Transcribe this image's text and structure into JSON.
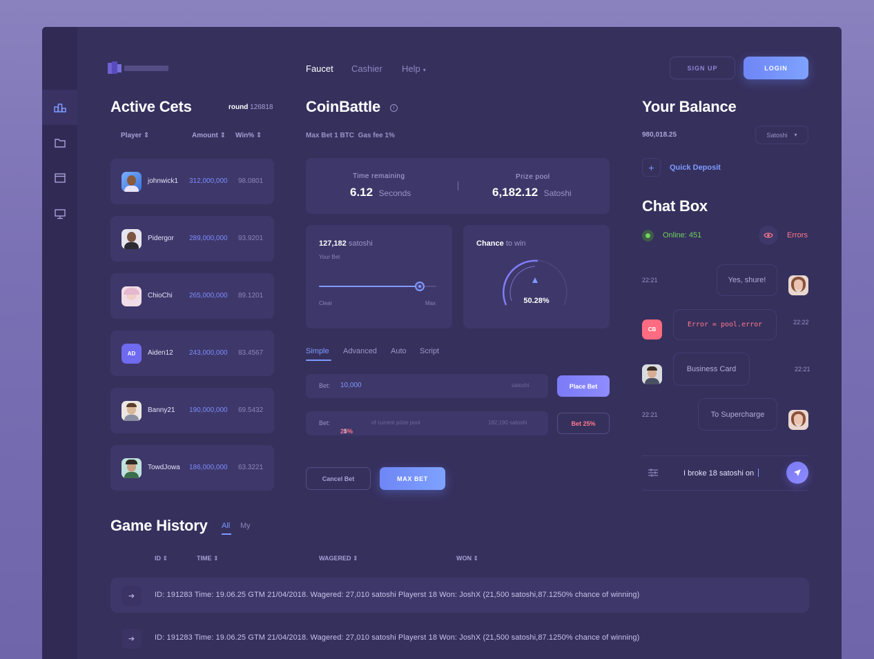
{
  "nav": {
    "faucet": "Faucet",
    "cashier": "Cashier",
    "help": "Help"
  },
  "auth": {
    "signup": "SIGN UP",
    "login": "LOGIN"
  },
  "active_bets": {
    "title": "Active Cets",
    "round_label": "round",
    "round_value": "126818",
    "columns": {
      "player": "Player",
      "amount": "Amount",
      "win": "Win%"
    },
    "rows": [
      {
        "name": "johnwick1",
        "amount": "312,000,000",
        "win": "98.0801",
        "avatar": "photo"
      },
      {
        "name": "Pidergor",
        "amount": "289,000,000",
        "win": "93.9201",
        "avatar": "photo"
      },
      {
        "name": "ChioChi",
        "amount": "265,000,000",
        "win": "89.1201",
        "avatar": "photo"
      },
      {
        "name": "Aiden12",
        "amount": "243,000,000",
        "win": "83.4567",
        "avatar": "AD"
      },
      {
        "name": "Banny21",
        "amount": "190,000,000",
        "win": "69.5432",
        "avatar": "photo"
      },
      {
        "name": "TowdJowa",
        "amount": "186,000,000",
        "win": "63.3221",
        "avatar": "photo"
      }
    ]
  },
  "coinbattle": {
    "title": "CoinBattle",
    "max_bet": "Max Bet 1 BTC",
    "gas_fee": "Gas fee 1%",
    "time_label": "Time remaining",
    "time_value": "6.12",
    "time_unit": "Seconds",
    "prize_label": "Prize pool",
    "prize_value": "6,182.12",
    "prize_unit": "Satoshi",
    "bet_value": "127,182",
    "bet_unit": "satoshi",
    "your_bet": "Your Bet",
    "clear": "Clear",
    "max": "Max",
    "slider_value": 0.86,
    "chance_label": "Chance",
    "chance_suffix": "to win",
    "chance_value": "50.28%",
    "tabs": [
      "Simple",
      "Advanced",
      "Auto",
      "Script"
    ],
    "bet_label": "Bet:",
    "bet_input": "10,000",
    "bet_input_unit": "satoshi",
    "place_bet": "Place Bet",
    "bet_pct": "25%",
    "pct_desc": "of current prize pool",
    "pct_amount": "182,190 satoshi",
    "bet25": "Bet 25%",
    "cancel": "Cancel Bet",
    "max_bet_btn": "MAX BET"
  },
  "balance": {
    "title": "Your Balance",
    "value": "980,018.25",
    "currency": "Satoshi",
    "quick_deposit": "Quick Deposit"
  },
  "chat": {
    "title": "Chat Box",
    "online": "Online: 451",
    "errors": "Errors",
    "messages": [
      {
        "time": "22:21",
        "text": "Yes, shure!"
      },
      {
        "time": "22:22",
        "text": "Error = pool.error",
        "avatar": "CB"
      },
      {
        "time": "22:21",
        "text": "Business Card"
      },
      {
        "time": "22:21",
        "text": "To Supercharge"
      }
    ],
    "input_value": "I broke 18 satoshi on"
  },
  "history": {
    "title": "Game History",
    "filter_all": "All",
    "filter_my": "My",
    "columns": {
      "id": "ID",
      "time": "TIME",
      "wagered": "WAGERED",
      "won": "WON"
    },
    "rows": [
      "ID: 191283  Time: 19.06.25 GTM 21/04/2018. Wagered: 27,010 satoshi Playerst 18 Won: JoshX (21,500 satoshi,87.1250% chance of winning)",
      "ID: 191283  Time: 19.06.25 GTM 21/04/2018. Wagered: 27,010 satoshi Playerst 18 Won: JoshX (21,500 satoshi,87.1250% chance of winning)"
    ]
  },
  "colors": {
    "accent": "#7f9bff",
    "error": "#ff7a8a",
    "online": "#6fd35a",
    "panel": "#3e3769",
    "bg": "#36305d"
  }
}
